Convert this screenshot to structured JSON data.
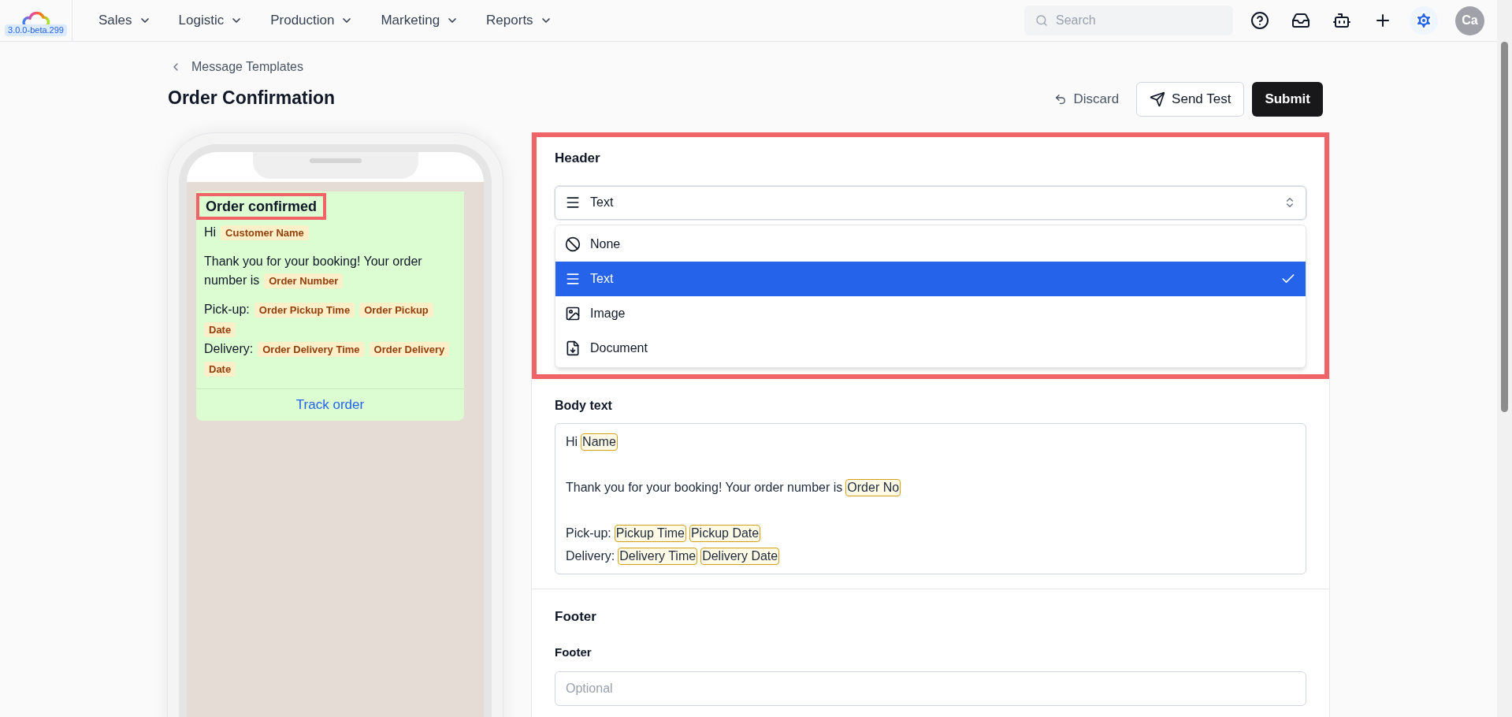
{
  "app": {
    "version": "3.0.0-beta.299"
  },
  "nav": {
    "menus": [
      {
        "label": "Sales"
      },
      {
        "label": "Logistic"
      },
      {
        "label": "Production"
      },
      {
        "label": "Marketing"
      },
      {
        "label": "Reports"
      }
    ],
    "search": {
      "placeholder": "Search"
    },
    "avatar": "Ca"
  },
  "breadcrumb": "Message Templates",
  "title": "Order Confirmation",
  "actions": [
    {
      "label": "Discard",
      "kind": "ghost"
    },
    {
      "label": "Send Test",
      "kind": "outline"
    },
    {
      "label": "Submit",
      "kind": "primary"
    }
  ],
  "preview": {
    "header": {
      "text": "Order confirmed",
      "highlighted": true
    },
    "paragraphs": [
      [
        [
          {
            "kind": "text",
            "text": "Hi"
          },
          {
            "kind": "var",
            "text": "Customer Name"
          }
        ]
      ],
      [
        [
          {
            "kind": "text",
            "text": "Thank you for your booking! Your order"
          },
          {
            "kind": "text",
            "text": "number is"
          },
          {
            "kind": "var",
            "text": "Order Number"
          }
        ]
      ],
      [
        [
          {
            "kind": "text",
            "text": "Pick-up:"
          },
          {
            "kind": "var",
            "text": "Order Pickup Time"
          },
          {
            "kind": "var",
            "text": "Order Pickup Date"
          }
        ],
        [
          {
            "kind": "text",
            "text": "Delivery:"
          },
          {
            "kind": "var",
            "text": "Order Delivery Time"
          },
          {
            "kind": "var",
            "text": "Order Delivery Date"
          }
        ]
      ]
    ],
    "button": "Track order"
  },
  "header_section": {
    "title": "Header",
    "highlighted": true,
    "select": {
      "value": "Text",
      "kind": "text",
      "expanded": true
    },
    "options": [
      {
        "label": "None",
        "kind": "none",
        "selected": false
      },
      {
        "label": "Text",
        "kind": "text",
        "selected": true
      },
      {
        "label": "Image",
        "kind": "image",
        "selected": false
      },
      {
        "label": "Document",
        "kind": "document",
        "selected": false
      }
    ]
  },
  "body_section": {
    "label": "Body text",
    "paragraphs": [
      [
        [
          {
            "kind": "text",
            "text": "Hi"
          },
          {
            "kind": "var",
            "text": "Name"
          }
        ]
      ],
      [
        [
          {
            "kind": "text",
            "text": "Thank you for your booking! Your order number is"
          },
          {
            "kind": "var",
            "text": "Order No"
          }
        ]
      ],
      [
        [
          {
            "kind": "text",
            "text": "Pick-up:"
          },
          {
            "kind": "var",
            "text": "Pickup Time"
          },
          {
            "kind": "var",
            "text": "Pickup Date"
          }
        ],
        [
          {
            "kind": "text",
            "text": "Delivery:"
          },
          {
            "kind": "var",
            "text": "Delivery Time"
          },
          {
            "kind": "var",
            "text": "Delivery Date"
          }
        ]
      ]
    ]
  },
  "footer_section": {
    "title": "Footer",
    "label": "Footer",
    "placeholder": "Optional"
  }
}
